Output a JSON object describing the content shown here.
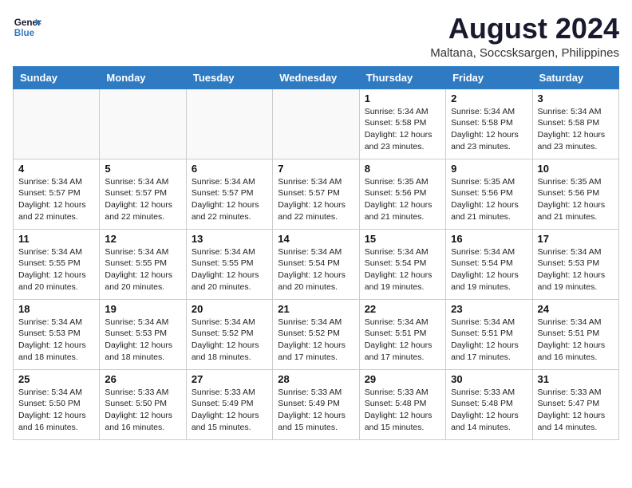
{
  "logo": {
    "line1": "General",
    "line2": "Blue"
  },
  "title": "August 2024",
  "location": "Maltana, Soccsksargen, Philippines",
  "days_of_week": [
    "Sunday",
    "Monday",
    "Tuesday",
    "Wednesday",
    "Thursday",
    "Friday",
    "Saturday"
  ],
  "weeks": [
    [
      {
        "day": "",
        "info": ""
      },
      {
        "day": "",
        "info": ""
      },
      {
        "day": "",
        "info": ""
      },
      {
        "day": "",
        "info": ""
      },
      {
        "day": "1",
        "info": "Sunrise: 5:34 AM\nSunset: 5:58 PM\nDaylight: 12 hours\nand 23 minutes."
      },
      {
        "day": "2",
        "info": "Sunrise: 5:34 AM\nSunset: 5:58 PM\nDaylight: 12 hours\nand 23 minutes."
      },
      {
        "day": "3",
        "info": "Sunrise: 5:34 AM\nSunset: 5:58 PM\nDaylight: 12 hours\nand 23 minutes."
      }
    ],
    [
      {
        "day": "4",
        "info": "Sunrise: 5:34 AM\nSunset: 5:57 PM\nDaylight: 12 hours\nand 22 minutes."
      },
      {
        "day": "5",
        "info": "Sunrise: 5:34 AM\nSunset: 5:57 PM\nDaylight: 12 hours\nand 22 minutes."
      },
      {
        "day": "6",
        "info": "Sunrise: 5:34 AM\nSunset: 5:57 PM\nDaylight: 12 hours\nand 22 minutes."
      },
      {
        "day": "7",
        "info": "Sunrise: 5:34 AM\nSunset: 5:57 PM\nDaylight: 12 hours\nand 22 minutes."
      },
      {
        "day": "8",
        "info": "Sunrise: 5:35 AM\nSunset: 5:56 PM\nDaylight: 12 hours\nand 21 minutes."
      },
      {
        "day": "9",
        "info": "Sunrise: 5:35 AM\nSunset: 5:56 PM\nDaylight: 12 hours\nand 21 minutes."
      },
      {
        "day": "10",
        "info": "Sunrise: 5:35 AM\nSunset: 5:56 PM\nDaylight: 12 hours\nand 21 minutes."
      }
    ],
    [
      {
        "day": "11",
        "info": "Sunrise: 5:34 AM\nSunset: 5:55 PM\nDaylight: 12 hours\nand 20 minutes."
      },
      {
        "day": "12",
        "info": "Sunrise: 5:34 AM\nSunset: 5:55 PM\nDaylight: 12 hours\nand 20 minutes."
      },
      {
        "day": "13",
        "info": "Sunrise: 5:34 AM\nSunset: 5:55 PM\nDaylight: 12 hours\nand 20 minutes."
      },
      {
        "day": "14",
        "info": "Sunrise: 5:34 AM\nSunset: 5:54 PM\nDaylight: 12 hours\nand 20 minutes."
      },
      {
        "day": "15",
        "info": "Sunrise: 5:34 AM\nSunset: 5:54 PM\nDaylight: 12 hours\nand 19 minutes."
      },
      {
        "day": "16",
        "info": "Sunrise: 5:34 AM\nSunset: 5:54 PM\nDaylight: 12 hours\nand 19 minutes."
      },
      {
        "day": "17",
        "info": "Sunrise: 5:34 AM\nSunset: 5:53 PM\nDaylight: 12 hours\nand 19 minutes."
      }
    ],
    [
      {
        "day": "18",
        "info": "Sunrise: 5:34 AM\nSunset: 5:53 PM\nDaylight: 12 hours\nand 18 minutes."
      },
      {
        "day": "19",
        "info": "Sunrise: 5:34 AM\nSunset: 5:53 PM\nDaylight: 12 hours\nand 18 minutes."
      },
      {
        "day": "20",
        "info": "Sunrise: 5:34 AM\nSunset: 5:52 PM\nDaylight: 12 hours\nand 18 minutes."
      },
      {
        "day": "21",
        "info": "Sunrise: 5:34 AM\nSunset: 5:52 PM\nDaylight: 12 hours\nand 17 minutes."
      },
      {
        "day": "22",
        "info": "Sunrise: 5:34 AM\nSunset: 5:51 PM\nDaylight: 12 hours\nand 17 minutes."
      },
      {
        "day": "23",
        "info": "Sunrise: 5:34 AM\nSunset: 5:51 PM\nDaylight: 12 hours\nand 17 minutes."
      },
      {
        "day": "24",
        "info": "Sunrise: 5:34 AM\nSunset: 5:51 PM\nDaylight: 12 hours\nand 16 minutes."
      }
    ],
    [
      {
        "day": "25",
        "info": "Sunrise: 5:34 AM\nSunset: 5:50 PM\nDaylight: 12 hours\nand 16 minutes."
      },
      {
        "day": "26",
        "info": "Sunrise: 5:33 AM\nSunset: 5:50 PM\nDaylight: 12 hours\nand 16 minutes."
      },
      {
        "day": "27",
        "info": "Sunrise: 5:33 AM\nSunset: 5:49 PM\nDaylight: 12 hours\nand 15 minutes."
      },
      {
        "day": "28",
        "info": "Sunrise: 5:33 AM\nSunset: 5:49 PM\nDaylight: 12 hours\nand 15 minutes."
      },
      {
        "day": "29",
        "info": "Sunrise: 5:33 AM\nSunset: 5:48 PM\nDaylight: 12 hours\nand 15 minutes."
      },
      {
        "day": "30",
        "info": "Sunrise: 5:33 AM\nSunset: 5:48 PM\nDaylight: 12 hours\nand 14 minutes."
      },
      {
        "day": "31",
        "info": "Sunrise: 5:33 AM\nSunset: 5:47 PM\nDaylight: 12 hours\nand 14 minutes."
      }
    ]
  ]
}
